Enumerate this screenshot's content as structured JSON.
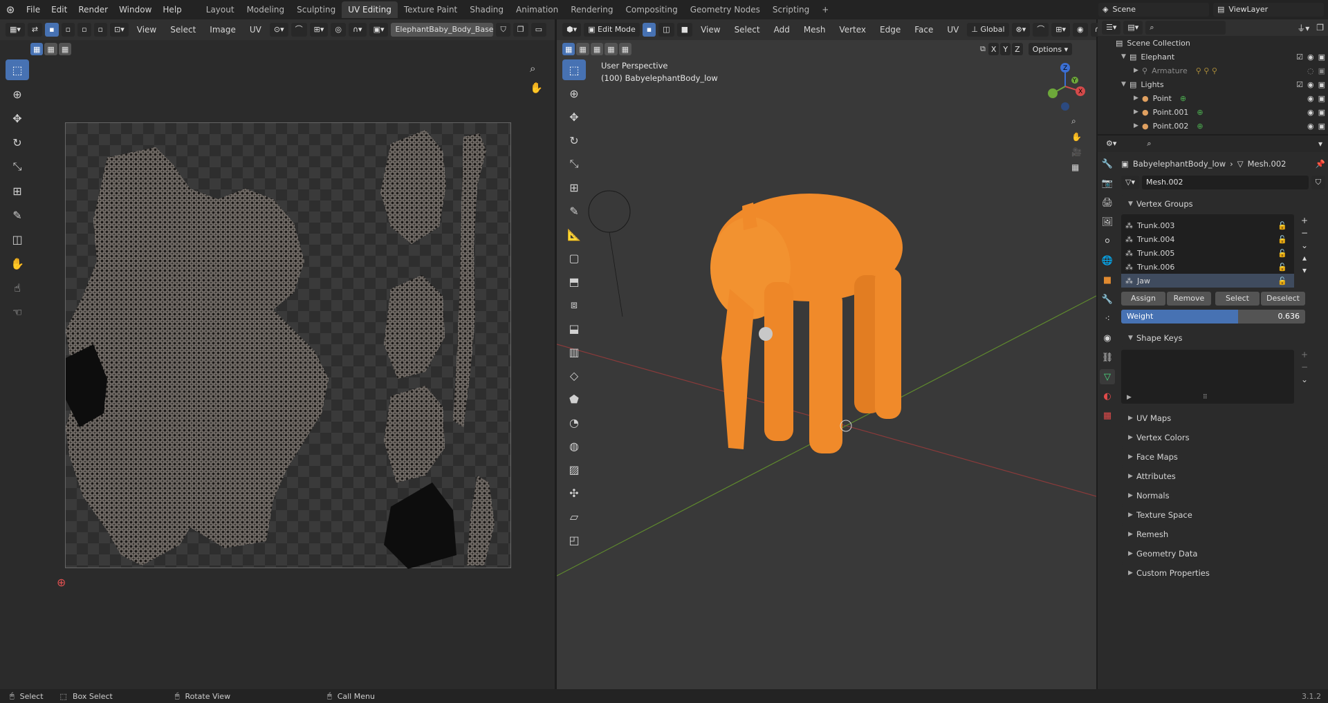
{
  "topbar": {
    "menus": [
      "File",
      "Edit",
      "Render",
      "Window",
      "Help"
    ],
    "workspaces": [
      "Layout",
      "Modeling",
      "Sculpting",
      "UV Editing",
      "Texture Paint",
      "Shading",
      "Animation",
      "Rendering",
      "Compositing",
      "Geometry Nodes",
      "Scripting"
    ],
    "active_workspace": "UV Editing",
    "scene": "Scene",
    "view_layer": "ViewLayer"
  },
  "uv_editor": {
    "menus": [
      "View",
      "Select",
      "Image",
      "UV"
    ],
    "image_name": "ElephantBaby_Body_Base_color.png"
  },
  "viewport": {
    "mode": "Edit Mode",
    "menus": [
      "View",
      "Select",
      "Add",
      "Mesh",
      "Vertex",
      "Edge",
      "Face",
      "UV"
    ],
    "transform_orientation": "Global",
    "axes": [
      "X",
      "Y",
      "Z"
    ],
    "options_label": "Options",
    "overlay_line1": "User Perspective",
    "overlay_line2": "(100) BabyelephantBody_low",
    "gizmo": {
      "z": "Z",
      "y": "Y",
      "x": "X"
    }
  },
  "outliner": {
    "root": "Scene Collection",
    "rows": [
      {
        "label": "Elephant"
      },
      {
        "label": "Armature"
      },
      {
        "label": "Lights"
      },
      {
        "label": "Point"
      },
      {
        "label": "Point.001"
      },
      {
        "label": "Point.002"
      }
    ]
  },
  "properties": {
    "object": "BabyelephantBody_low",
    "mesh": "Mesh.002",
    "mesh_field": "Mesh.002",
    "vertex_groups_title": "Vertex Groups",
    "vertex_groups": [
      "Trunk.003",
      "Trunk.004",
      "Trunk.005",
      "Trunk.006",
      "Jaw"
    ],
    "assign": "Assign",
    "remove": "Remove",
    "select": "Select",
    "deselect": "Deselect",
    "weight_label": "Weight",
    "weight_value": "0.636",
    "weight_fraction": 0.636,
    "shape_keys_title": "Shape Keys",
    "sections": [
      "UV Maps",
      "Vertex Colors",
      "Face Maps",
      "Attributes",
      "Normals",
      "Texture Space",
      "Remesh",
      "Geometry Data",
      "Custom Properties"
    ]
  },
  "status": {
    "select": "Select",
    "box_select": "Box Select",
    "rotate_view": "Rotate View",
    "call_menu": "Call Menu",
    "version": "3.1.2"
  },
  "colors": {
    "accent": "#4772b3",
    "selection": "#ff8a1a",
    "bg": "#303030"
  }
}
